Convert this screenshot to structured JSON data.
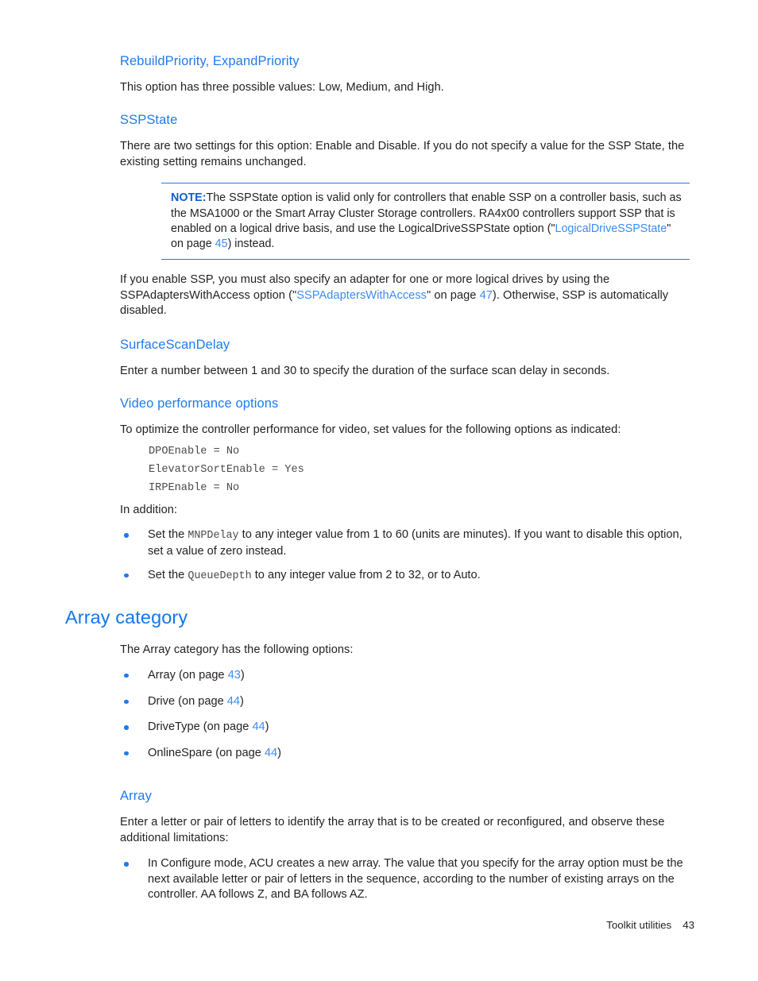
{
  "document": {
    "footer": {
      "label": "Toolkit utilities",
      "page_number": "43"
    }
  },
  "colors": {
    "heading_blue": "#1f7bee",
    "h1_blue": "#1277e8",
    "link_blue": "#3d8bf2",
    "note_label_blue": "#0a5fd0",
    "body_text": "#231f20",
    "code_text": "#4a4a4a",
    "bullet_blue": "#1f7bee"
  },
  "sections": {
    "rebuild_priority": {
      "heading": "RebuildPriority, ExpandPriority",
      "paragraph": "This option has three possible values: Low, Medium, and High."
    },
    "ssp_state": {
      "heading": "SSPState",
      "paragraph": "There are two settings for this option: Enable and Disable. If you do not specify a value for the SSP State, the existing setting remains unchanged.",
      "note": {
        "label": "NOTE:",
        "text_before_link": "The SSPState option is valid only for controllers that enable SSP on a controller basis, such as the MSA1000 or the Smart Array Cluster Storage controllers. RA4x00 controllers support SSP that is enabled on a logical drive basis, and use the LogicalDriveSSPState option (\"",
        "link_text": "LogicalDriveSSPState",
        "text_mid": "\" on page ",
        "page_ref": "45",
        "text_after": ") instead."
      },
      "paragraph_after_before_link": "If you enable SSP, you must also specify an adapter for one or more logical drives by using the SSPAdaptersWithAccess option (\"",
      "paragraph_after_link": "SSPAdaptersWithAccess",
      "paragraph_after_mid": "\" on page ",
      "paragraph_after_page_ref": "47",
      "paragraph_after_tail": "). Otherwise, SSP is automatically disabled."
    },
    "surface_scan_delay": {
      "heading": "SurfaceScanDelay",
      "paragraph": "Enter a number between 1 and 30 to specify the duration of the surface scan delay in seconds."
    },
    "video_performance": {
      "heading": "Video performance options",
      "paragraph": "To optimize the controller performance for video, set values for the following options as indicated:",
      "code_lines": [
        "DPOEnable = No",
        "ElevatorSortEnable = Yes",
        "IRPEnable = No"
      ],
      "lead_in": "In addition:",
      "bullets": [
        {
          "prefix": "Set the ",
          "code": "MNPDelay",
          "suffix": " to any integer value from 1 to 60 (units are minutes). If you want to disable this option, set a value of zero instead."
        },
        {
          "prefix": "Set the ",
          "code": "QueueDepth",
          "suffix": " to any integer value from 2 to 32, or to Auto."
        }
      ]
    },
    "array_category": {
      "heading": "Array category",
      "paragraph": "The Array category has the following options:",
      "options": [
        {
          "name": "Array",
          "on_page": "(on page ",
          "page": "43",
          "close": ")"
        },
        {
          "name": "Drive",
          "on_page": "(on page ",
          "page": "44",
          "close": ")"
        },
        {
          "name": "DriveType",
          "on_page": "(on page ",
          "page": "44",
          "close": ")"
        },
        {
          "name": "OnlineSpare",
          "on_page": "(on page ",
          "page": "44",
          "close": ")"
        }
      ]
    },
    "array": {
      "heading": "Array",
      "paragraph": "Enter a letter or pair of letters to identify the array that is to be created or reconfigured, and observe these additional limitations:",
      "bullets": [
        "In Configure mode, ACU creates a new array. The value that you specify for the array option must be the next available letter or pair of letters in the sequence, according to the number of existing arrays on the controller. AA follows Z, and BA follows AZ."
      ]
    }
  }
}
